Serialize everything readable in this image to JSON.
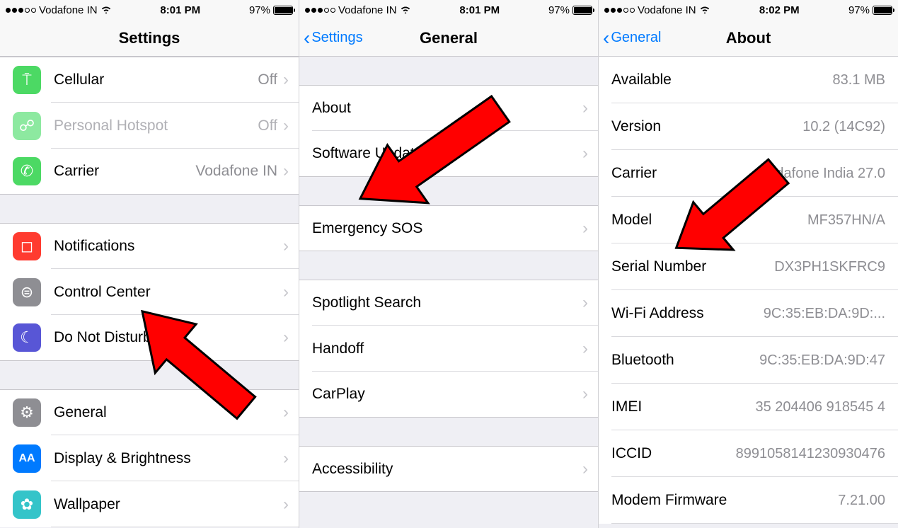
{
  "status": {
    "carrier": "Vodafone IN",
    "time1": "8:01 PM",
    "time2": "8:01 PM",
    "time3": "8:02 PM",
    "battery": "97%"
  },
  "pane1": {
    "title": "Settings",
    "rows": {
      "cellular": {
        "label": "Cellular",
        "value": "Off"
      },
      "hotspot": {
        "label": "Personal Hotspot",
        "value": "Off"
      },
      "carrier": {
        "label": "Carrier",
        "value": "Vodafone IN"
      },
      "notifications": {
        "label": "Notifications"
      },
      "controlcenter": {
        "label": "Control Center"
      },
      "dnd": {
        "label": "Do Not Disturb"
      },
      "general": {
        "label": "General"
      },
      "display": {
        "label": "Display & Brightness"
      },
      "wallpaper": {
        "label": "Wallpaper"
      }
    }
  },
  "pane2": {
    "back": "Settings",
    "title": "General",
    "rows": {
      "about": {
        "label": "About"
      },
      "software": {
        "label": "Software Update"
      },
      "sos": {
        "label": "Emergency SOS"
      },
      "spotlight": {
        "label": "Spotlight Search"
      },
      "handoff": {
        "label": "Handoff"
      },
      "carplay": {
        "label": "CarPlay"
      },
      "accessibility": {
        "label": "Accessibility"
      }
    }
  },
  "pane3": {
    "back": "General",
    "title": "About",
    "rows": {
      "available": {
        "label": "Available",
        "value": "83.1 MB"
      },
      "version": {
        "label": "Version",
        "value": "10.2 (14C92)"
      },
      "carrier": {
        "label": "Carrier",
        "value": "Vodafone India 27.0"
      },
      "model": {
        "label": "Model",
        "value": "MF357HN/A"
      },
      "serial": {
        "label": "Serial Number",
        "value": "DX3PH1SKFRC9"
      },
      "wifi": {
        "label": "Wi-Fi Address",
        "value": "9C:35:EB:DA:9D:..."
      },
      "bluetooth": {
        "label": "Bluetooth",
        "value": "9C:35:EB:DA:9D:47"
      },
      "imei": {
        "label": "IMEI",
        "value": "35 204406 918545 4"
      },
      "iccid": {
        "label": "ICCID",
        "value": "8991058141230930476"
      },
      "modem": {
        "label": "Modem Firmware",
        "value": "7.21.00"
      }
    }
  }
}
